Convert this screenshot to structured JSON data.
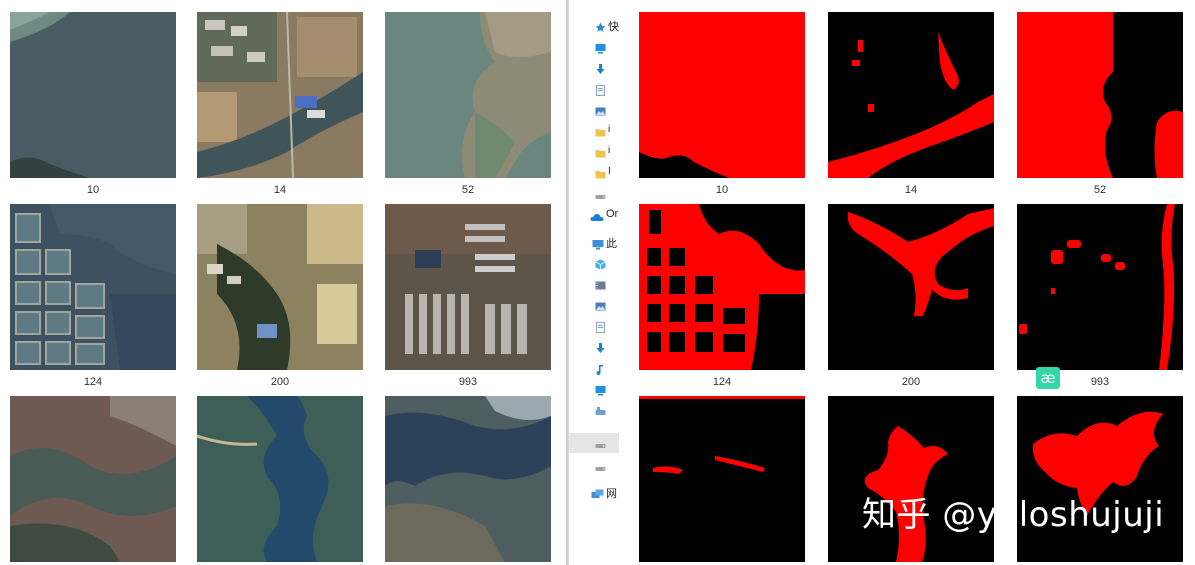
{
  "left_thumbnails": [
    {
      "label": "10",
      "kind": "satellite-lake"
    },
    {
      "label": "14",
      "kind": "satellite-village"
    },
    {
      "label": "52",
      "kind": "satellite-shore"
    },
    {
      "label": "124",
      "kind": "satellite-ponds"
    },
    {
      "label": "200",
      "kind": "satellite-trees"
    },
    {
      "label": "993",
      "kind": "satellite-town"
    },
    {
      "label": "",
      "kind": "satellite-hills"
    },
    {
      "label": "",
      "kind": "satellite-reservoir"
    },
    {
      "label": "",
      "kind": "satellite-bay"
    }
  ],
  "right_thumbnails": [
    {
      "label": "10",
      "kind": "mask-lake"
    },
    {
      "label": "14",
      "kind": "mask-river"
    },
    {
      "label": "52",
      "kind": "mask-shore"
    },
    {
      "label": "124",
      "kind": "mask-ponds"
    },
    {
      "label": "200",
      "kind": "mask-branch"
    },
    {
      "label": "993",
      "kind": "mask-spots"
    },
    {
      "label": "",
      "kind": "mask-strip"
    },
    {
      "label": "",
      "kind": "mask-reservoir"
    },
    {
      "label": "",
      "kind": "mask-bay"
    }
  ],
  "nav": {
    "items": [
      {
        "label": "快",
        "icon": "star-icon",
        "color": "#2b88d8"
      },
      {
        "label": "",
        "icon": "desktop-icon",
        "color": "#1e90e0"
      },
      {
        "label": "",
        "icon": "download-icon",
        "color": "#1e7fd6"
      },
      {
        "label": "",
        "icon": "document-icon",
        "color": "#8aa4c0"
      },
      {
        "label": "",
        "icon": "picture-icon",
        "color": "#4a7fb5"
      },
      {
        "label": "i",
        "icon": "folder-icon",
        "color": "#f0c14b"
      },
      {
        "label": "i",
        "icon": "folder-icon",
        "color": "#f0c14b"
      },
      {
        "label": "I",
        "icon": "folder-icon",
        "color": "#f0c14b"
      },
      {
        "label": "",
        "icon": "drive-icon",
        "color": "#9aa0a6"
      },
      {
        "label": "Or",
        "icon": "cloud-icon",
        "color": "#1e7fd6"
      },
      {
        "label": "此",
        "icon": "computer-icon",
        "color": "#3a8fd6"
      },
      {
        "label": "",
        "icon": "cube-icon",
        "color": "#3fb0e8"
      },
      {
        "label": "",
        "icon": "video-icon",
        "color": "#6b7d8f"
      },
      {
        "label": "",
        "icon": "picture-icon",
        "color": "#4a7fb5"
      },
      {
        "label": "",
        "icon": "document-icon",
        "color": "#8aa4c0"
      },
      {
        "label": "",
        "icon": "download-icon",
        "color": "#1e7fd6"
      },
      {
        "label": "",
        "icon": "music-icon",
        "color": "#1e7fd6"
      },
      {
        "label": "",
        "icon": "desktop-icon",
        "color": "#1e90e0"
      },
      {
        "label": "",
        "icon": "drive-icon",
        "color": "#6d9fd0"
      },
      {
        "label": "",
        "icon": "drive-icon",
        "color": "#9aa0a6"
      },
      {
        "label": "",
        "icon": "drive-icon",
        "color": "#9aa0a6"
      },
      {
        "label": "网",
        "icon": "network-icon",
        "color": "#3a8fd6"
      }
    ]
  },
  "watermark": "知乎 @yoloshujuji",
  "badge": "æ",
  "colors": {
    "mask_fg": "#ff0000",
    "mask_bg": "#000000",
    "lake": "#4f5e66"
  }
}
